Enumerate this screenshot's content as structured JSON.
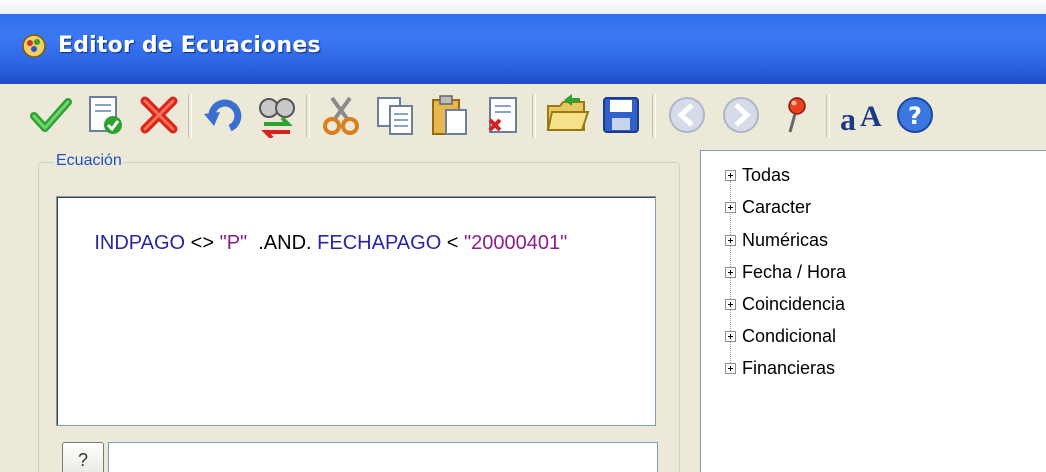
{
  "window": {
    "title": "Editor de Ecuaciones",
    "app_icon": "equation-editor-app-icon"
  },
  "toolbar": {
    "buttons": [
      {
        "name": "accept-checkmark-icon",
        "enabled": true
      },
      {
        "name": "validate-document-icon",
        "enabled": true
      },
      {
        "name": "cancel-x-icon",
        "enabled": true
      },
      {
        "name": "undo-icon",
        "enabled": true
      },
      {
        "name": "replace-icon",
        "enabled": true
      },
      {
        "name": "cut-scissors-icon",
        "enabled": true
      },
      {
        "name": "copy-icon",
        "enabled": true
      },
      {
        "name": "paste-icon",
        "enabled": true
      },
      {
        "name": "delete-document-icon",
        "enabled": true
      },
      {
        "name": "open-folder-icon",
        "enabled": true
      },
      {
        "name": "save-disk-icon",
        "enabled": true
      },
      {
        "name": "back-arrow-icon",
        "enabled": false
      },
      {
        "name": "forward-arrow-icon",
        "enabled": false
      },
      {
        "name": "pin-icon",
        "enabled": true
      },
      {
        "name": "font-icon",
        "enabled": true
      },
      {
        "name": "help-icon",
        "enabled": true
      }
    ]
  },
  "equation": {
    "group_label": "Ecuación",
    "tokens": [
      {
        "text": "INDPAGO",
        "kind": "ident"
      },
      {
        "text": " <> ",
        "kind": "op"
      },
      {
        "text": "\"P\"",
        "kind": "str"
      },
      {
        "text": "  .AND. ",
        "kind": "op"
      },
      {
        "text": "FECHAPAGO",
        "kind": "ident"
      },
      {
        "text": " < ",
        "kind": "op"
      },
      {
        "text": "\"20000401\"",
        "kind": "str"
      }
    ],
    "help_button_label": "?",
    "bottom_input_value": ""
  },
  "functions_tree": {
    "items": [
      {
        "label": "Todas"
      },
      {
        "label": "Caracter"
      },
      {
        "label": "Numéricas"
      },
      {
        "label": "Fecha / Hora"
      },
      {
        "label": "Coincidencia"
      },
      {
        "label": "Condicional"
      },
      {
        "label": "Financieras"
      }
    ]
  },
  "colors": {
    "title_bar": "#2f6ff0",
    "identifier": "#2727a6",
    "string": "#8a1e8a",
    "group_label": "#1f50c0"
  }
}
